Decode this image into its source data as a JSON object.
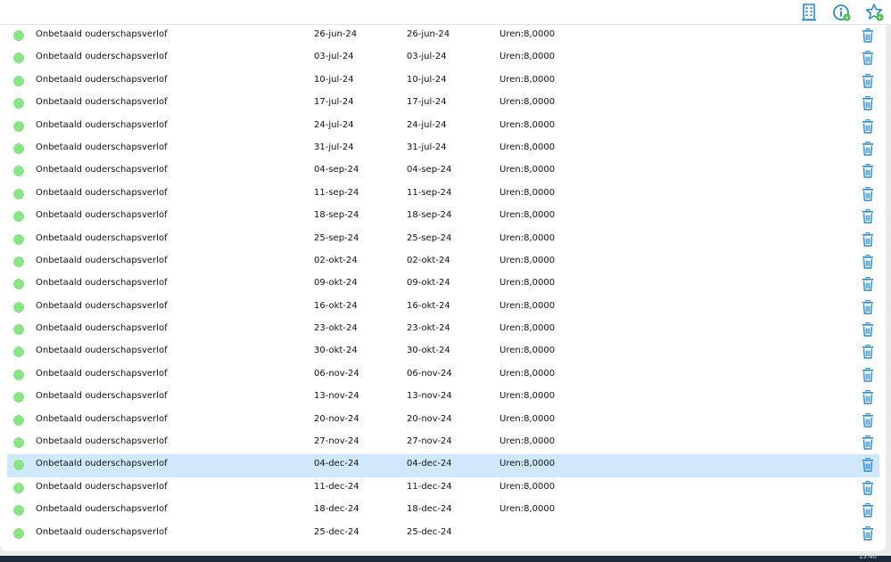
{
  "toolbar": {
    "icons": [
      "building-icon",
      "info-add-icon",
      "star-add-icon"
    ]
  },
  "colors": {
    "status_green": "#8be587",
    "accent_blue": "#2a8ccf",
    "selected_row": "#cfe9fa"
  },
  "rows": [
    {
      "type": "Onbetaald ouderschapsverlof",
      "start": "26-jun-24",
      "end": "26-jun-24",
      "hours": "Uren:8,0000"
    },
    {
      "type": "Onbetaald ouderschapsverlof",
      "start": "03-jul-24",
      "end": "03-jul-24",
      "hours": "Uren:8,0000"
    },
    {
      "type": "Onbetaald ouderschapsverlof",
      "start": "10-jul-24",
      "end": "10-jul-24",
      "hours": "Uren:8,0000"
    },
    {
      "type": "Onbetaald ouderschapsverlof",
      "start": "17-jul-24",
      "end": "17-jul-24",
      "hours": "Uren:8,0000"
    },
    {
      "type": "Onbetaald ouderschapsverlof",
      "start": "24-jul-24",
      "end": "24-jul-24",
      "hours": "Uren:8,0000"
    },
    {
      "type": "Onbetaald ouderschapsverlof",
      "start": "31-jul-24",
      "end": "31-jul-24",
      "hours": "Uren:8,0000"
    },
    {
      "type": "Onbetaald ouderschapsverlof",
      "start": "04-sep-24",
      "end": "04-sep-24",
      "hours": "Uren:8,0000"
    },
    {
      "type": "Onbetaald ouderschapsverlof",
      "start": "11-sep-24",
      "end": "11-sep-24",
      "hours": "Uren:8,0000"
    },
    {
      "type": "Onbetaald ouderschapsverlof",
      "start": "18-sep-24",
      "end": "18-sep-24",
      "hours": "Uren:8,0000"
    },
    {
      "type": "Onbetaald ouderschapsverlof",
      "start": "25-sep-24",
      "end": "25-sep-24",
      "hours": "Uren:8,0000"
    },
    {
      "type": "Onbetaald ouderschapsverlof",
      "start": "02-okt-24",
      "end": "02-okt-24",
      "hours": "Uren:8,0000"
    },
    {
      "type": "Onbetaald ouderschapsverlof",
      "start": "09-okt-24",
      "end": "09-okt-24",
      "hours": "Uren:8,0000"
    },
    {
      "type": "Onbetaald ouderschapsverlof",
      "start": "16-okt-24",
      "end": "16-okt-24",
      "hours": "Uren:8,0000"
    },
    {
      "type": "Onbetaald ouderschapsverlof",
      "start": "23-okt-24",
      "end": "23-okt-24",
      "hours": "Uren:8,0000"
    },
    {
      "type": "Onbetaald ouderschapsverlof",
      "start": "30-okt-24",
      "end": "30-okt-24",
      "hours": "Uren:8,0000"
    },
    {
      "type": "Onbetaald ouderschapsverlof",
      "start": "06-nov-24",
      "end": "06-nov-24",
      "hours": "Uren:8,0000"
    },
    {
      "type": "Onbetaald ouderschapsverlof",
      "start": "13-nov-24",
      "end": "13-nov-24",
      "hours": "Uren:8,0000"
    },
    {
      "type": "Onbetaald ouderschapsverlof",
      "start": "20-nov-24",
      "end": "20-nov-24",
      "hours": "Uren:8,0000"
    },
    {
      "type": "Onbetaald ouderschapsverlof",
      "start": "27-nov-24",
      "end": "27-nov-24",
      "hours": "Uren:8,0000"
    },
    {
      "type": "Onbetaald ouderschapsverlof",
      "start": "04-dec-24",
      "end": "04-dec-24",
      "hours": "Uren:8,0000",
      "selected": true
    },
    {
      "type": "Onbetaald ouderschapsverlof",
      "start": "11-dec-24",
      "end": "11-dec-24",
      "hours": "Uren:8,0000"
    },
    {
      "type": "Onbetaald ouderschapsverlof",
      "start": "18-dec-24",
      "end": "18-dec-24",
      "hours": "Uren:8,0000"
    },
    {
      "type": "Onbetaald ouderschapsverlof",
      "start": "25-dec-24",
      "end": "25-dec-24",
      "hours": ""
    }
  ],
  "taskbar": {
    "clock": "15:40"
  }
}
